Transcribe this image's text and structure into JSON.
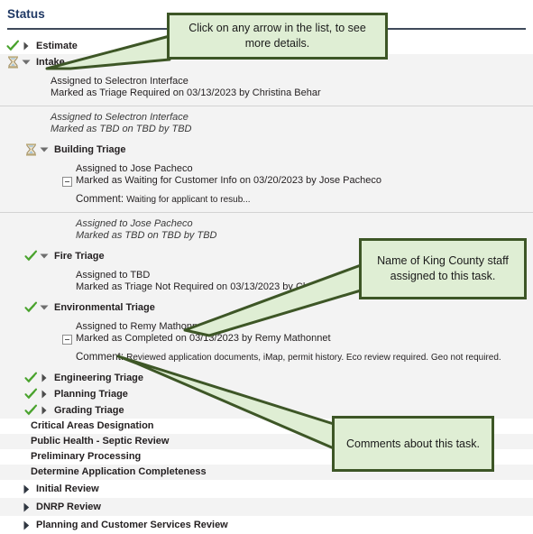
{
  "header": {
    "title": "Status"
  },
  "colors": {
    "callout_fill": "#dfeed4",
    "callout_border": "#3d5626",
    "check_green": "#4aa32e",
    "title_navy": "#1f3864",
    "row_shade": "#f3f3f3"
  },
  "annotations": [
    {
      "id": "arrows",
      "text": "Click on any arrow in the list, to see more details."
    },
    {
      "id": "staff",
      "text": "Name of King County staff assigned to this task."
    },
    {
      "id": "comments",
      "text": "Comments about this task."
    }
  ],
  "tree": {
    "estimate": {
      "label": "Estimate",
      "status_icon": "check-icon",
      "arrow_icon": "arrow-right-icon"
    },
    "intake": {
      "label": "Intake",
      "status_icon": "hourglass-icon",
      "arrow_icon": "arrow-down-icon",
      "details": [
        {
          "assigned": "Assigned to Selectron Interface",
          "marked": "Marked as Triage Required on 03/13/2023 by Christina Behar",
          "pending": false,
          "has_toggle": false,
          "comment_label": null,
          "comment_text": null
        },
        {
          "assigned": "Assigned to Selectron Interface",
          "marked": "Marked as TBD on TBD by TBD",
          "pending": true,
          "has_toggle": false,
          "comment_label": null,
          "comment_text": null
        }
      ]
    },
    "building_triage": {
      "label": "Building Triage",
      "status_icon": "hourglass-icon",
      "arrow_icon": "arrow-down-icon",
      "details": [
        {
          "assigned": "Assigned to Jose Pacheco",
          "marked": "Marked as Waiting for Customer Info on 03/20/2023 by Jose Pacheco",
          "pending": false,
          "has_toggle": true,
          "comment_label": "Comment:",
          "comment_text": "Waiting for applicant to resub..."
        },
        {
          "assigned": "Assigned to Jose Pacheco",
          "marked": "Marked as TBD on TBD by TBD",
          "pending": true,
          "has_toggle": false,
          "comment_label": null,
          "comment_text": null
        }
      ]
    },
    "fire_triage": {
      "label": "Fire Triage",
      "status_icon": "check-icon",
      "arrow_icon": "arrow-down-icon",
      "details": [
        {
          "assigned": "Assigned to TBD",
          "marked": "Marked as Triage Not Required on 03/13/2023 by Christina Behar",
          "pending": false,
          "has_toggle": false,
          "comment_label": null,
          "comment_text": null
        }
      ]
    },
    "environmental_triage": {
      "label": "Environmental Triage",
      "status_icon": "check-icon",
      "arrow_icon": "arrow-down-icon",
      "details": [
        {
          "assigned": "Assigned to Remy Mathonnet",
          "marked": "Marked as Completed on 03/13/2023 by Remy Mathonnet",
          "pending": false,
          "has_toggle": true,
          "comment_label": "Comment:",
          "comment_text": "Reviewed application documents, iMap, permit history. Eco review required. Geo not required."
        }
      ]
    },
    "collapsed_children": [
      {
        "label": "Engineering Triage",
        "status_icon": "check-icon",
        "arrow_icon": "arrow-right-icon"
      },
      {
        "label": "Planning Triage",
        "status_icon": "check-icon",
        "arrow_icon": "arrow-right-icon"
      },
      {
        "label": "Grading Triage",
        "status_icon": "check-icon",
        "arrow_icon": "arrow-right-icon"
      }
    ],
    "leaf_tasks": [
      {
        "label": "Critical Areas Designation"
      },
      {
        "label": "Public Health - Septic Review"
      },
      {
        "label": "Preliminary Processing"
      },
      {
        "label": "Determine Application Completeness"
      }
    ],
    "top_level_collapsed": [
      {
        "label": "Initial Review",
        "arrow_icon": "arrow-right-icon"
      },
      {
        "label": "DNRP Review",
        "arrow_icon": "arrow-right-icon"
      },
      {
        "label": "Planning and Customer Services Review",
        "arrow_icon": "arrow-right-icon"
      }
    ]
  }
}
